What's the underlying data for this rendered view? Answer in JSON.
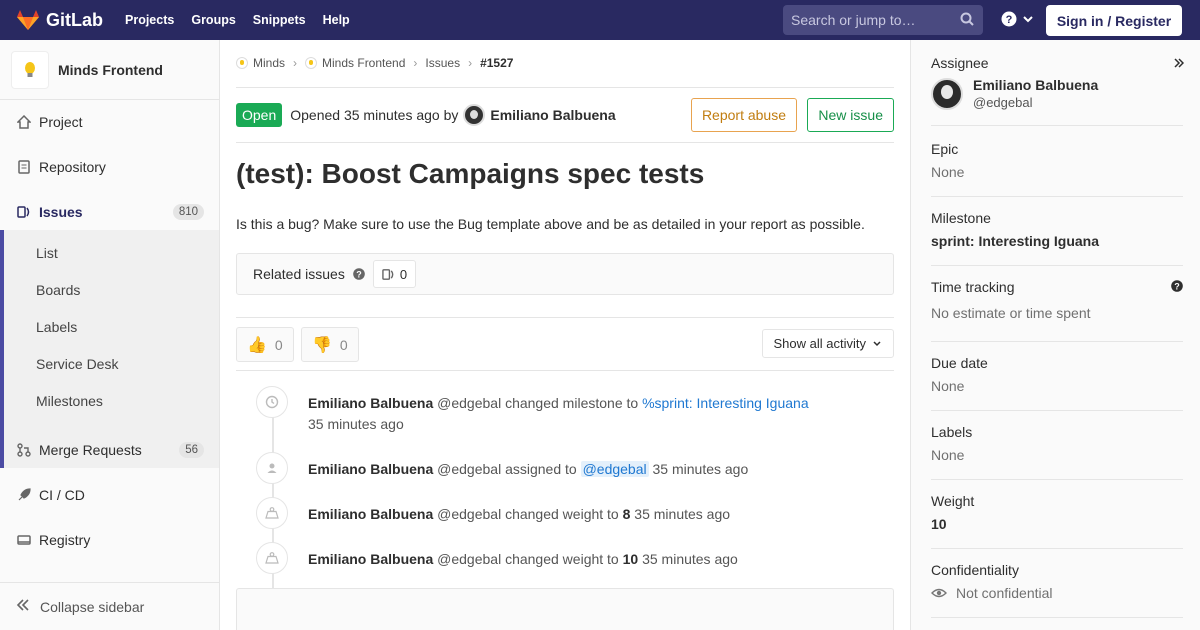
{
  "navbar": {
    "brand": "GitLab",
    "links": [
      "Projects",
      "Groups",
      "Snippets",
      "Help"
    ],
    "search_placeholder": "Search or jump to…",
    "sign_in": "Sign in / Register"
  },
  "sidebar": {
    "project_name": "Minds Frontend",
    "items": [
      {
        "label": "Project",
        "icon": "home-icon"
      },
      {
        "label": "Repository",
        "icon": "doc-icon"
      },
      {
        "label": "Issues",
        "icon": "issues-icon",
        "badge": "810"
      },
      {
        "label": "Merge Requests",
        "icon": "merge-icon",
        "badge": "56"
      },
      {
        "label": "CI / CD",
        "icon": "rocket-icon"
      },
      {
        "label": "Registry",
        "icon": "container-icon"
      }
    ],
    "issues_sub": [
      "List",
      "Boards",
      "Labels",
      "Service Desk",
      "Milestones"
    ],
    "collapse": "Collapse sidebar"
  },
  "breadcrumb": {
    "items": [
      "Minds",
      "Minds Frontend",
      "Issues",
      "#1527"
    ]
  },
  "issue": {
    "status": "Open",
    "opened_text": "Opened 35 minutes ago by",
    "author": "Emiliano Balbuena",
    "report_abuse": "Report abuse",
    "new_issue": "New issue",
    "title": "(test): Boost Campaigns spec tests",
    "description": "Is this a bug? Make sure to use the Bug template above and be as detailed in your report as possible.",
    "related_label": "Related issues",
    "related_count": "0",
    "thumbs_up": "0",
    "thumbs_down": "0",
    "activity_filter": "Show all activity"
  },
  "notes": [
    {
      "author": "Emiliano Balbuena",
      "handle": "@edgebal",
      "action": "changed milestone to",
      "link": "%sprint: Interesting Iguana",
      "time": "35 minutes ago",
      "icon": "clock-icon"
    },
    {
      "author": "Emiliano Balbuena",
      "handle": "@edgebal",
      "action": "assigned to",
      "mention": "@edgebal",
      "time": "35 minutes ago",
      "icon": "user-icon"
    },
    {
      "author": "Emiliano Balbuena",
      "handle": "@edgebal",
      "action": "changed weight to",
      "value": "8",
      "time": "35 minutes ago",
      "icon": "weight-icon"
    },
    {
      "author": "Emiliano Balbuena",
      "handle": "@edgebal",
      "action": "changed weight to",
      "value": "10",
      "time": "35 minutes ago",
      "icon": "weight-icon"
    }
  ],
  "right_sidebar": {
    "assignee_title": "Assignee",
    "assignee_name": "Emiliano Balbuena",
    "assignee_handle": "@edgebal",
    "epic_title": "Epic",
    "epic_value": "None",
    "milestone_title": "Milestone",
    "milestone_value": "sprint: Interesting Iguana",
    "time_title": "Time tracking",
    "time_value": "No estimate or time spent",
    "due_title": "Due date",
    "due_value": "None",
    "labels_title": "Labels",
    "labels_value": "None",
    "weight_title": "Weight",
    "weight_value": "10",
    "conf_title": "Confidentiality",
    "conf_value": "Not confidential"
  },
  "colors": {
    "navbar": "#292961",
    "accent": "#4b4ba3",
    "open": "#1aaa55",
    "report": "#e8a34f",
    "link": "#1f78d1"
  }
}
